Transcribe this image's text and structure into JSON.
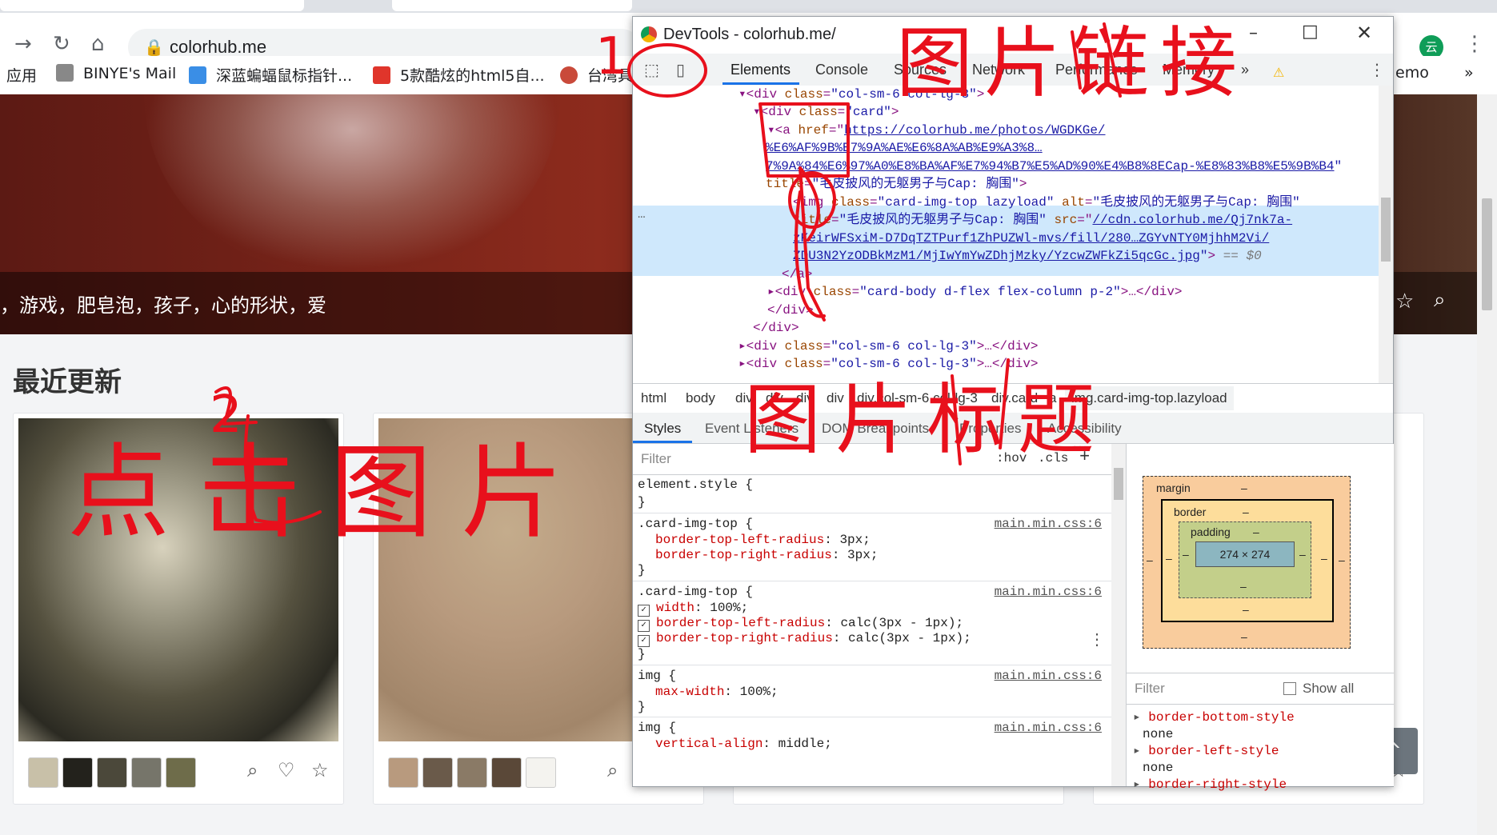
{
  "browser": {
    "url": "colorhub.me",
    "bookmarks": [
      {
        "label": "应用",
        "icon": "apps-icon"
      },
      {
        "label": "BINYE's Mail",
        "icon": "mail-icon"
      },
      {
        "label": "深蓝蝙蝠鼠标指针...",
        "icon": "bat-icon"
      },
      {
        "label": "5款酷炫的html5自...",
        "icon": "html5-icon"
      },
      {
        "label": "台湾具",
        "icon": "star-badge-icon"
      },
      {
        "label": "emo",
        "icon": ""
      }
    ],
    "more_bookmarks": "»",
    "profile_initial": "云"
  },
  "page": {
    "hero_tags": "，游戏，肥皂泡，孩子，心的形状，爱",
    "section_title": "最近更新",
    "cards": [
      {
        "swatches": [
          "#c8c0a8",
          "#23221c",
          "#4b483a",
          "#76756a",
          "#6e6c4a"
        ]
      },
      {
        "swatches": [
          "#b89a7e",
          "#6a5a4a",
          "#8a7a66",
          "#5a4838",
          "#f4f3ef"
        ]
      }
    ],
    "back_to_top": "^"
  },
  "devtools": {
    "title": "DevTools - colorhub.me/",
    "tabs": [
      "Elements",
      "Console",
      "Sources",
      "Network",
      "Performance",
      "Memory"
    ],
    "more_tabs": "»",
    "dom_lines": {
      "l1_tag": "<div",
      "l1_attr": "class",
      "l1_val": "\"col-sm-6 col-lg-3\"",
      "l1_end": ">",
      "l2_tag": "<div",
      "l2_attr": "class",
      "l2_val": "\"card\"",
      "l2_end": ">",
      "l3_tag": "<a",
      "l3_attr": "href",
      "l3_url1": "https://colorhub.me/photos/WGDKGe/",
      "l3_url2": "%E6%AF%9B%E7%9A%AE%E6%8A%AB%E9%A3%8…",
      "l3_url3": "7%9A%84%E6%97%A0%E8%BA%AF%E7%94%B7%E5%AD%90%E4%B8%8ECap-%E8%83%B8%E5%9B%B4",
      "l3_title_attr": "title",
      "l3_title_val": "\"毛皮披风的无躯男子与Cap: 胸围\"",
      "img_tag": "<img",
      "img_class_attr": "class",
      "img_class_val": "\"card-img-top lazyload\"",
      "img_alt_attr": "alt",
      "img_alt_val": "\"毛皮披风的无躯男子与Cap: 胸围\"",
      "img_title_attr": "title",
      "img_title_val": "\"毛皮披风的无躯男子与Cap: 胸围\"",
      "img_src_attr": "src",
      "img_src1": "//cdn.colorhub.me/Qj7nk7a-",
      "img_src2": "zKeirWFSxiM-D7DqTZTPurf1ZhPUZWl-mvs/fill/280…ZGYvNTY0MjhhM2Vi/",
      "img_src3": "ZDU3N2YzODBkMzM1/MjIwYmYwZDhjMzky/YzcwZWFkZi5qcGc.jpg",
      "img_eq": "== $0",
      "a_close": "</a>",
      "body_div": "class",
      "body_div_val": "\"card-body d-flex flex-column p-2\"",
      "body_div_end": ">…</div>",
      "div_close1": "</div>",
      "div_close2": "</div>",
      "next_div": "\"col-sm-6 col-lg-3\"",
      "next_div_end": ">…</div>",
      "next_div2": "\"col-sm-6 col-lg-3\""
    },
    "breadcrumbs": [
      "html",
      "body",
      "div",
      "div",
      "div",
      "div",
      "div.col-sm-6.col-lg-3",
      "div.card",
      "a",
      "img.card-img-top.lazyload"
    ],
    "subtabs": [
      "Styles",
      "Event Listeners",
      "DOM Breakpoints",
      "Properties",
      "Accessibility"
    ],
    "styles_filter_placeholder": "Filter",
    "hov": ":hov",
    "cls": ".cls",
    "plus": "+",
    "rules": [
      {
        "selector": "element.style {",
        "close": "}"
      },
      {
        "selector": ".card-img-top {",
        "source": "main.min.css:6",
        "props": [
          [
            "border-top-left-radius",
            "3px;"
          ],
          [
            "border-top-right-radius",
            "3px;"
          ]
        ],
        "close": "}"
      },
      {
        "selector": ".card-img-top {",
        "source": "main.min.css:6",
        "props": [
          [
            "width",
            "100%;"
          ],
          [
            "border-top-left-radius",
            "calc(3px - 1px);"
          ],
          [
            "border-top-right-radius",
            "calc(3px - 1px);"
          ]
        ],
        "close": "}"
      },
      {
        "selector": "img {",
        "source": "main.min.css:6",
        "props": [
          [
            "max-width",
            "100%;"
          ]
        ],
        "close": "}"
      },
      {
        "selector": "img {",
        "source": "main.min.css:6",
        "props": [
          [
            "vertical-align",
            "middle;"
          ]
        ]
      }
    ],
    "boxmodel": {
      "margin": "margin",
      "border": "border",
      "padding": "padding",
      "content": "274 × 274",
      "dash": "–"
    },
    "computed_filter_placeholder": "Filter",
    "show_all": "Show all",
    "computed": [
      {
        "name": "border-bottom-style",
        "value": "none"
      },
      {
        "name": "border-left-style",
        "value": "none"
      },
      {
        "name": "border-right-style",
        "value": ""
      }
    ]
  },
  "annotations": {
    "n1": "1",
    "n2": "2",
    "a1": "图片链接",
    "a2": "点击图片",
    "a3": "图片标题"
  }
}
